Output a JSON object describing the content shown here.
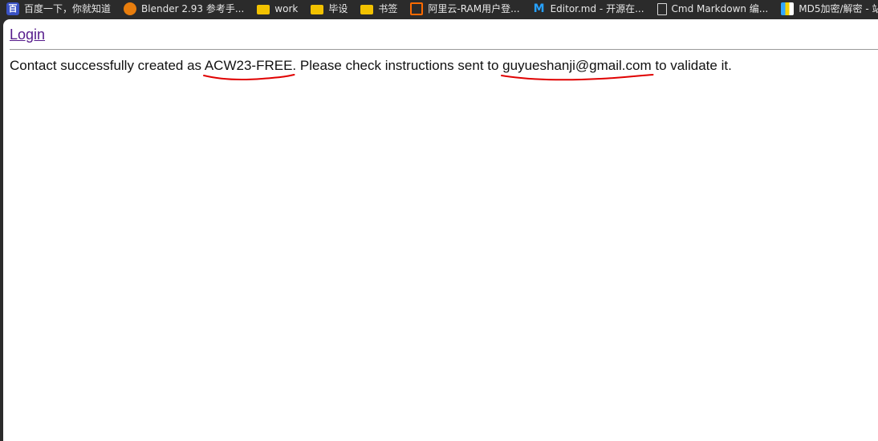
{
  "bookmarks": [
    {
      "label": "百度一下，你就知道",
      "icon": "baidu-icon"
    },
    {
      "label": "Blender 2.93 参考手...",
      "icon": "blender-icon"
    },
    {
      "label": "work",
      "icon": "folder-icon"
    },
    {
      "label": "毕设",
      "icon": "folder-icon"
    },
    {
      "label": "书签",
      "icon": "folder-icon"
    },
    {
      "label": "阿里云-RAM用户登...",
      "icon": "aliyun-icon"
    },
    {
      "label": "Editor.md - 开源在...",
      "icon": "m-icon"
    },
    {
      "label": "Cmd Markdown 编...",
      "icon": "document-icon"
    },
    {
      "label": "MD5加密/解密 - 站...",
      "icon": "md5-icon"
    }
  ],
  "page": {
    "login_link": "Login",
    "message": {
      "prefix": "Contact successfully created as ",
      "contact_id": "ACW23-FREE",
      "middle": ". Please check instructions sent to ",
      "email": "guyueshanji@gmail.com",
      "suffix": " to validate it."
    }
  },
  "colors": {
    "link_visited": "#551a8b",
    "annotation_red": "#e00000",
    "browser_chrome": "#2b2b2b"
  }
}
